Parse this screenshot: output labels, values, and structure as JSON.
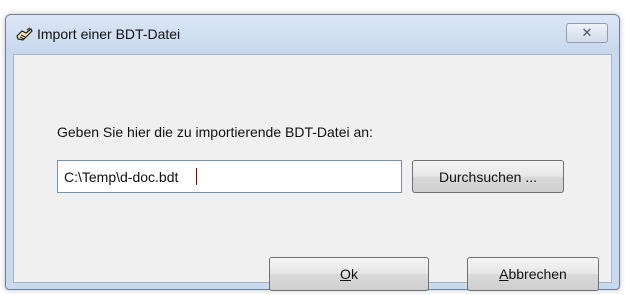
{
  "window": {
    "title": "Import einer BDT-Datei",
    "close_symbol": "✕"
  },
  "dialog": {
    "prompt": "Geben Sie hier die zu importierende BDT-Datei an:",
    "file_path": "C:\\Temp\\d-doc.bdt",
    "browse_label": "Durchsuchen ...",
    "ok_mnemonic": "O",
    "ok_rest": "k",
    "cancel_mnemonic": "A",
    "cancel_rest": "bbrechen"
  },
  "icons": {
    "app": "hand-pen-icon",
    "close": "close-icon"
  }
}
